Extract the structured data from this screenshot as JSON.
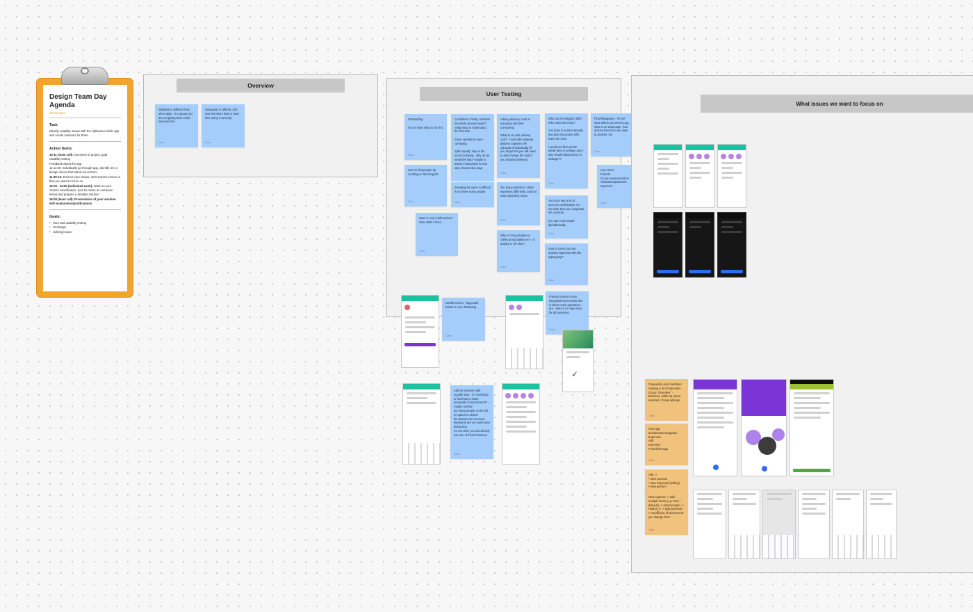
{
  "agenda": {
    "title": "Design Team Day Agenda",
    "date": "28.05.2021",
    "task_heading": "Task",
    "task_text": "Identify usability issues with the Splitwise mobile app and create solutions for them.",
    "action_heading": "Action Items:",
    "action_items": [
      {
        "bold": "10-11 (team call):",
        "text": " Overview of project, goal"
      },
      {
        "bold": "",
        "text": "Usability testing"
      },
      {
        "bold": "",
        "text": "Feedback about the app"
      },
      {
        "bold": "",
        "text": "11-11:30: Individually go through app, identify UX or design issues that stand out to them"
      },
      {
        "bold": "11:30-12:",
        "text": " Present your issues, select which screen or flow you want to focus on"
      },
      {
        "bold": "12:00 - 16:00 (individual work):",
        "text": " Work on your chosen view/feature, (can be same as someone elses) and prepare a detailed solution"
      },
      {
        "bold": "16:00 (team call): Presentation of your solution with explanation/justifications",
        "text": ""
      }
    ],
    "goals_heading": "Goals:",
    "goals": [
      "User and usability testing",
      "UI Design",
      "Solving issues"
    ]
  },
  "sections": {
    "overview": "Overview",
    "user_testing": "User Testing",
    "focus": "What issues we want to focus on"
  },
  "overview_notes": [
    {
      "text": "Splitwise is different from other apps - in a group you are not giving back to the same person",
      "author": "Clara"
    },
    {
      "text": "Navigation is difficult, and new members have a hard time using it correctly",
      "author": "Clara"
    }
  ],
  "testing_notes": [
    {
      "text": "Onboarding\n\nIt's not clear what to do first",
      "author": "Clara"
    },
    {
      "text": "Hard to find people by scrolling on this long list",
      "author": "Clara"
    },
    {
      "text": "Save is very small and not clear what it does",
      "author": "Clara"
    },
    {
      "text": "Confidence: Pretty confident but whole process wasn't really easy to understand the first time\n\nSome operations were confusing\n\nSplit 'equally' step is the most confusing - why do we need this step? maybe a button instead and in next step choose who pays",
      "author": ""
    },
    {
      "text": "Browsing for users is difficult if you have many people",
      "author": "Clara"
    },
    {
      "text": "Adding delivery costs is annoying and time consuming\n\nWhat to do with delivery cost? - must add separate delivery expense OR calculate it individually (if you forget this you will need to also change the total if you included delivery)",
      "author": "Clara"
    },
    {
      "text": "Too many options to share expenses differently, and not clear what they mean",
      "author": "Clara"
    },
    {
      "text": "Why is Group Balances called group balances? = it activity or s/h else?",
      "author": "Clara"
    },
    {
      "text": "Who has the biggest debt? Who owes the most?\n\nYou have to scroll manually and pick the person who owes the most\n\nI would not find out the whole debt in settings area - why should balances be in settings??",
      "author": "Clara"
    },
    {
      "text": "You don't see a lot of success confirmation, it's not clear that you completed sth correctly.\n\nyou can't sort people alphabetically",
      "author": "Clara"
    },
    {
      "text": "How to check you are sharing expenses with the right group?",
      "author": "Clara"
    },
    {
      "text": "Flow/Navigation - it's not clear where you need to go, what is on what page, how actions flow from one view to another, etc.",
      "author": "Clara"
    },
    {
      "text": "Use cases\nFriends\nGroup events/vacation\nFlatmates/apartment expenses",
      "author": "Clara"
    },
    {
      "text": "Friends screen is very important but not clear this is where main operations are - there's no main area for all expenses",
      "author": "Clara"
    },
    {
      "text": "Details screen - big purple button is very distracting",
      "author": "Clara"
    },
    {
      "text": "Add an expense split equally view - it's confusing to find how to share unequally \"exact amounts\" - maybe unclear\ntoo many people on the list - no option to search\nthe buttons are not clear\nelephants are not useful and distracting\nIt's not clear you should only use one of these functions",
      "author": "Clara"
    }
  ],
  "focus_notes": [
    {
      "text": "Frequently used members\nViewing a lot of expenses\nGroup \"Overview\" - balances, settle up, Send invitation, Group settings",
      "author": "Clara"
    },
    {
      "text": "New app architecture/navigation\nExpenses\nAdd\nOverview\nFriends/Groups",
      "author": "Clara"
    },
    {
      "text": "Add ->\n  •  New expense\n  •  New Payment (settling)\n  •  New person?",
      "author": ""
    },
    {
      "text": "New expense -> add multiple items (e.g. food + delivery) -> select people -> Paid by X -> Split payment -> Autofill rest of amounts as you change them",
      "author": "Clara"
    }
  ],
  "colors": {
    "clipboard": "#f2a52e",
    "sticky_blue": "#a4cdfb",
    "sticky_orange": "#f0c27c",
    "splitwise_green": "#1cc29f",
    "accent_purple": "#7b35d6"
  }
}
